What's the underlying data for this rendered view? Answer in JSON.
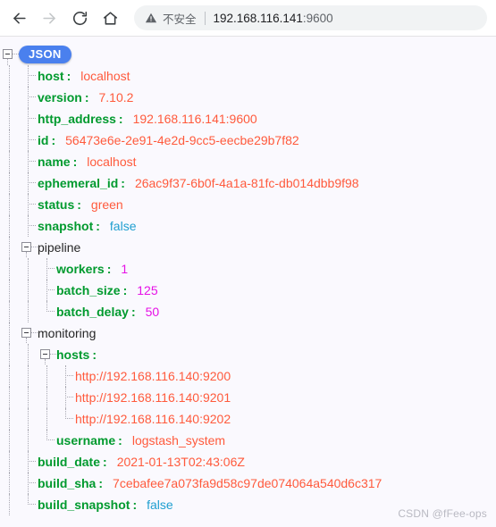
{
  "browser": {
    "back_icon": "arrow-left-icon",
    "forward_icon": "arrow-right-icon",
    "reload_icon": "reload-icon",
    "home_icon": "home-icon",
    "warning_icon": "warning-triangle-icon",
    "insecure_label": "不安全",
    "url_host": "192.168.116.141",
    "url_port": ":9600"
  },
  "viewer": {
    "root_badge": "JSON",
    "watermark": "CSDN @fFee-ops",
    "colors": {
      "key": "#009a2e",
      "string": "#ff5a3c",
      "number": "#e612e6",
      "boolean": "#1f9fd0",
      "badge": "#4a80ee",
      "background": "#faf9fe"
    },
    "colon": ":"
  },
  "json": {
    "host": {
      "key": "host",
      "value": "localhost"
    },
    "version": {
      "key": "version",
      "value": "7.10.2"
    },
    "http_address": {
      "key": "http_address",
      "value": "192.168.116.141:9600"
    },
    "id": {
      "key": "id",
      "value": "56473e6e-2e91-4e2d-9cc5-eecbe29b7f82"
    },
    "name": {
      "key": "name",
      "value": "localhost"
    },
    "ephemeral_id": {
      "key": "ephemeral_id",
      "value": "26ac9f37-6b0f-4a1a-81fc-db014dbb9f98"
    },
    "status": {
      "key": "status",
      "value": "green"
    },
    "snapshot": {
      "key": "snapshot",
      "value": "false"
    },
    "pipeline": {
      "label": "pipeline",
      "workers": {
        "key": "workers",
        "value": "1"
      },
      "batch_size": {
        "key": "batch_size",
        "value": "125"
      },
      "batch_delay": {
        "key": "batch_delay",
        "value": "50"
      }
    },
    "monitoring": {
      "label": "monitoring",
      "hosts": {
        "key": "hosts",
        "items": [
          "http://192.168.116.140:9200",
          "http://192.168.116.140:9201",
          "http://192.168.116.140:9202"
        ]
      },
      "username": {
        "key": "username",
        "value": "logstash_system"
      }
    },
    "build_date": {
      "key": "build_date",
      "value": "2021-01-13T02:43:06Z"
    },
    "build_sha": {
      "key": "build_sha",
      "value": "7cebafee7a073fa9d58c97de074064a540d6c317"
    },
    "build_snapshot": {
      "key": "build_snapshot",
      "value": "false"
    }
  }
}
